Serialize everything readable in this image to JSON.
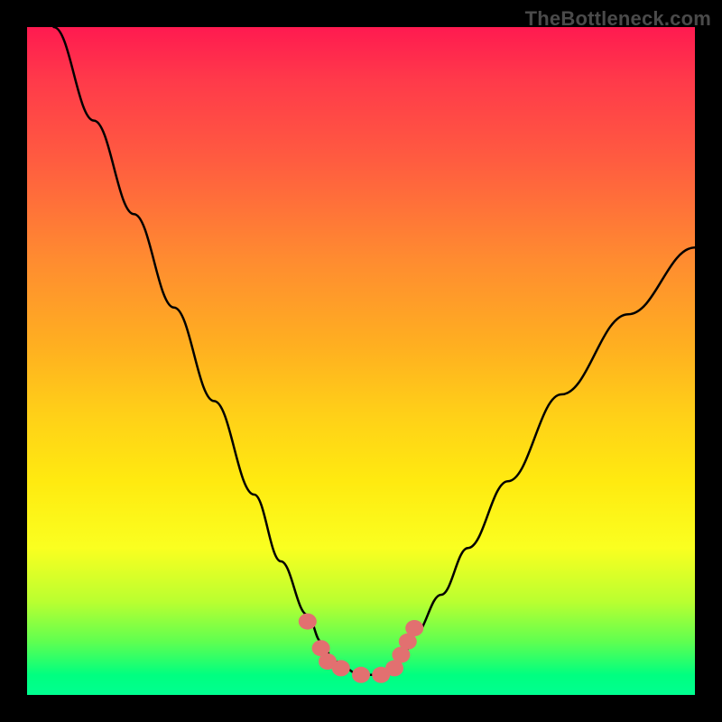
{
  "watermark": "TheBottleneck.com",
  "chart_data": {
    "type": "line",
    "title": "",
    "xlabel": "",
    "ylabel": "",
    "xlim": [
      0,
      100
    ],
    "ylim": [
      0,
      100
    ],
    "grid": false,
    "series": [
      {
        "name": "bottleneck-line",
        "x": [
          4,
          10,
          16,
          22,
          28,
          34,
          38,
          42,
          44,
          46,
          50,
          54,
          56,
          58,
          62,
          66,
          72,
          80,
          90,
          100
        ],
        "values": [
          100,
          86,
          72,
          58,
          44,
          30,
          20,
          12,
          8,
          5,
          3,
          3,
          5,
          9,
          15,
          22,
          32,
          45,
          57,
          67
        ]
      }
    ],
    "markers": {
      "name": "highlight-points",
      "color": "#e27070",
      "x": [
        42,
        44,
        45,
        47,
        50,
        53,
        55,
        56,
        57,
        58
      ],
      "values": [
        11,
        7,
        5,
        4,
        3,
        3,
        4,
        6,
        8,
        10
      ]
    },
    "background": {
      "type": "vertical-gradient",
      "stops": [
        {
          "pos": 0,
          "color": "#ff1a50"
        },
        {
          "pos": 50,
          "color": "#ffd018"
        },
        {
          "pos": 90,
          "color": "#60ff50"
        },
        {
          "pos": 100,
          "color": "#00ff90"
        }
      ]
    }
  }
}
